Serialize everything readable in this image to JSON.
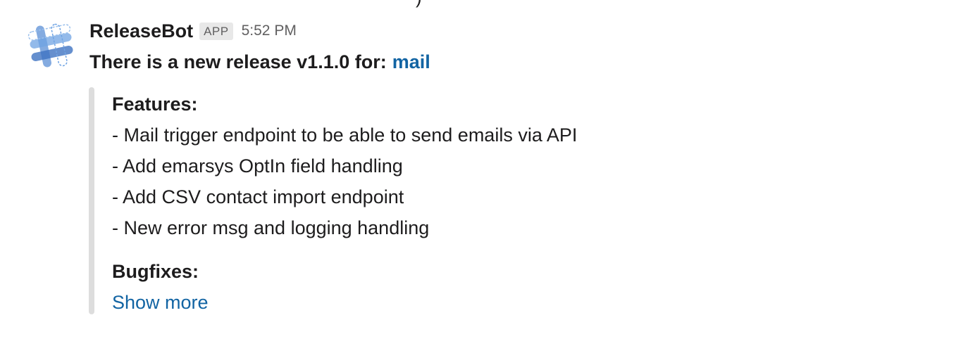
{
  "top_fragment": ")",
  "message": {
    "sender": "ReleaseBot",
    "badge": "APP",
    "timestamp": "5:52 PM",
    "text_prefix": "There is a new release v1.1.0 for:",
    "link_text": "mail",
    "avatar_icon": "slack-hashtag-logo-icon",
    "attachment": {
      "features_heading": "Features:",
      "features": [
        "- Mail trigger endpoint to be able to send emails via API",
        "- Add emarsys OptIn field handling",
        "- Add CSV contact import endpoint",
        "- New error msg and logging handling"
      ],
      "bugfixes_heading": "Bugfixes:",
      "show_more": "Show more",
      "bar_color": "#dddddd"
    }
  },
  "colors": {
    "link": "#1264a3",
    "text": "#1d1c1d",
    "muted": "#616061"
  }
}
